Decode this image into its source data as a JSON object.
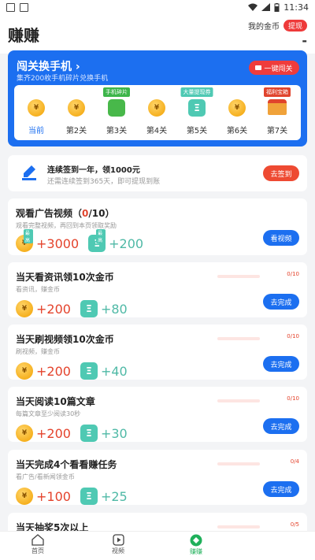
{
  "status_bar": {
    "time": "11:34"
  },
  "header": {
    "title": "赚赚",
    "coin_label": "我的金币",
    "withdraw_label": "提现",
    "coin_value": "-"
  },
  "level_card": {
    "title": "闯关换手机",
    "subtitle": "集齐200枚手机碎片兑换手机",
    "one_key_label": "一键闯关",
    "levels": [
      {
        "name": "当前",
        "badge": "",
        "icon": "coin-icon",
        "current": true
      },
      {
        "name": "第2关",
        "badge": "",
        "icon": "coin-icon"
      },
      {
        "name": "第3关",
        "badge": "手机碎片",
        "icon": "puzzle-icon"
      },
      {
        "name": "第4关",
        "badge": "",
        "icon": "coin-icon"
      },
      {
        "name": "第5关",
        "badge": "大量提现券",
        "icon": "ticket-icon"
      },
      {
        "name": "第6关",
        "badge": "",
        "icon": "coin-icon"
      },
      {
        "name": "第7关",
        "badge": "福利宝箱",
        "icon": "chest-icon"
      }
    ]
  },
  "checkin": {
    "title": "连续签到一年，领1000元",
    "subtitle": "还需连续签到365天，即可提现到账",
    "button": "去签到"
  },
  "ad_task": {
    "title": "观看广告视频",
    "progress_open": "（",
    "progress_done": "0",
    "progress_total": "/10）",
    "subtitle": "观看完整视频，再回到本页领取奖励",
    "coin_reward": "+3000",
    "ticket_reward": "+200",
    "max_tag": "最高",
    "button": "看视频"
  },
  "tasks": [
    {
      "title": "当天看资讯领10次金币",
      "subtitle": "看资讯，赚金币",
      "progress": "0/10",
      "progress_fraction": 0,
      "coin_reward": "+200",
      "ticket_reward": "+80",
      "button": "去完成"
    },
    {
      "title": "当天刷视频领10次金币",
      "subtitle": "刷视频，赚金币",
      "progress": "0/10",
      "progress_fraction": 0,
      "coin_reward": "+200",
      "ticket_reward": "+40",
      "button": "去完成"
    },
    {
      "title": "当天阅读10篇文章",
      "subtitle": "每篇文章至少阅读30秒",
      "progress": "0/10",
      "progress_fraction": 0,
      "coin_reward": "+200",
      "ticket_reward": "+30",
      "button": "去完成"
    },
    {
      "title": "当天完成4个看看赚任务",
      "subtitle": "看广告/看新闻领金币",
      "progress": "0/4",
      "progress_fraction": 0,
      "coin_reward": "+100",
      "ticket_reward": "+25",
      "button": "去完成"
    },
    {
      "title": "当天抽奖5次以上",
      "subtitle": "",
      "progress": "0/5",
      "progress_fraction": 0,
      "coin_reward": "",
      "ticket_reward": "",
      "button": ""
    }
  ],
  "tabbar": [
    {
      "label": "首页",
      "icon": "home-icon"
    },
    {
      "label": "视频",
      "icon": "video-icon"
    },
    {
      "label": "赚赚",
      "icon": "earn-icon",
      "active": true
    }
  ],
  "colors": {
    "primary_blue": "#1c6ff0",
    "red": "#ee4a32",
    "coin_text": "#e4432c",
    "ticket_text": "#4fb9a6",
    "active_tab": "#1fb05a"
  }
}
